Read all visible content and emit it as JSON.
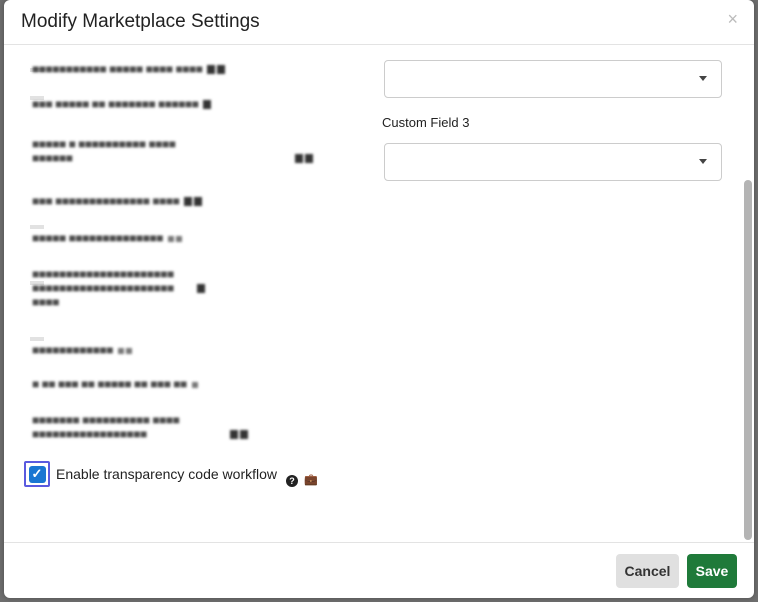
{
  "modal": {
    "title": "Modify Marketplace Settings",
    "close_glyph": "×"
  },
  "settings": {
    "custom_field_label": "Custom Field 3",
    "transparency_label": "Enable transparency code workflow",
    "transparency_checked": true
  },
  "footer": {
    "cancel_label": "Cancel",
    "save_label": "Save"
  },
  "colors": {
    "save": "#1f7a3a",
    "checkbox": "#1a76d2",
    "focus_ring": "#5a5adf"
  },
  "icons": [
    "close-icon",
    "caret-down-icon",
    "question-circle-icon",
    "briefcase-icon",
    "checkmark-icon"
  ]
}
